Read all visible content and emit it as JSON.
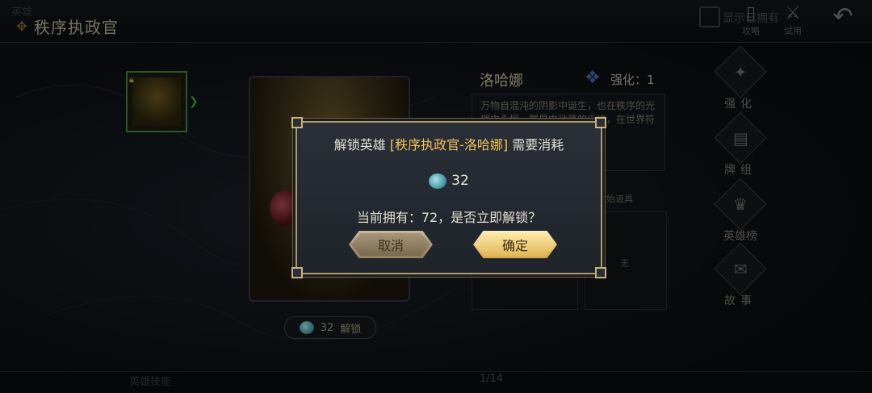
{
  "header": {
    "title": "秩序执政官",
    "ghost_text": "英雄",
    "checkbox_label": "显示已拥有",
    "guide_label": "攻略",
    "trial_label": "试用"
  },
  "hero": {
    "name": "洛哈娜",
    "enhance_label": "强化：1",
    "description": "万物自混沌的阴影中诞生，也在秩序的光辉中永恒。群星中动荡的尘埃，在世界符文。",
    "items_header": "初始道具",
    "items_none": "无",
    "unlock_cost": "32",
    "unlock_label": "解锁"
  },
  "side_nav": {
    "items": [
      {
        "label": "强化",
        "icon": "enhance-icon"
      },
      {
        "label": "牌组",
        "icon": "deck-icon"
      },
      {
        "label": "英雄榜",
        "icon": "ranking-icon"
      },
      {
        "label": "故事",
        "icon": "story-icon"
      }
    ]
  },
  "footer": {
    "page_indicator": "1/14",
    "ghost_text": "英雄技能"
  },
  "dialog": {
    "prefix": "解锁英雄 ",
    "highlight": "[秩序执政官-洛哈娜]",
    "suffix": " 需要消耗",
    "cost": "32",
    "owned_text": "当前拥有：72，是否立即解锁？",
    "cancel_label": "取消",
    "confirm_label": "确定"
  },
  "colors": {
    "accent_gold": "#f0c15a",
    "frame_gold": "#b09a6d",
    "hero_slot_green": "#3c8a33"
  }
}
